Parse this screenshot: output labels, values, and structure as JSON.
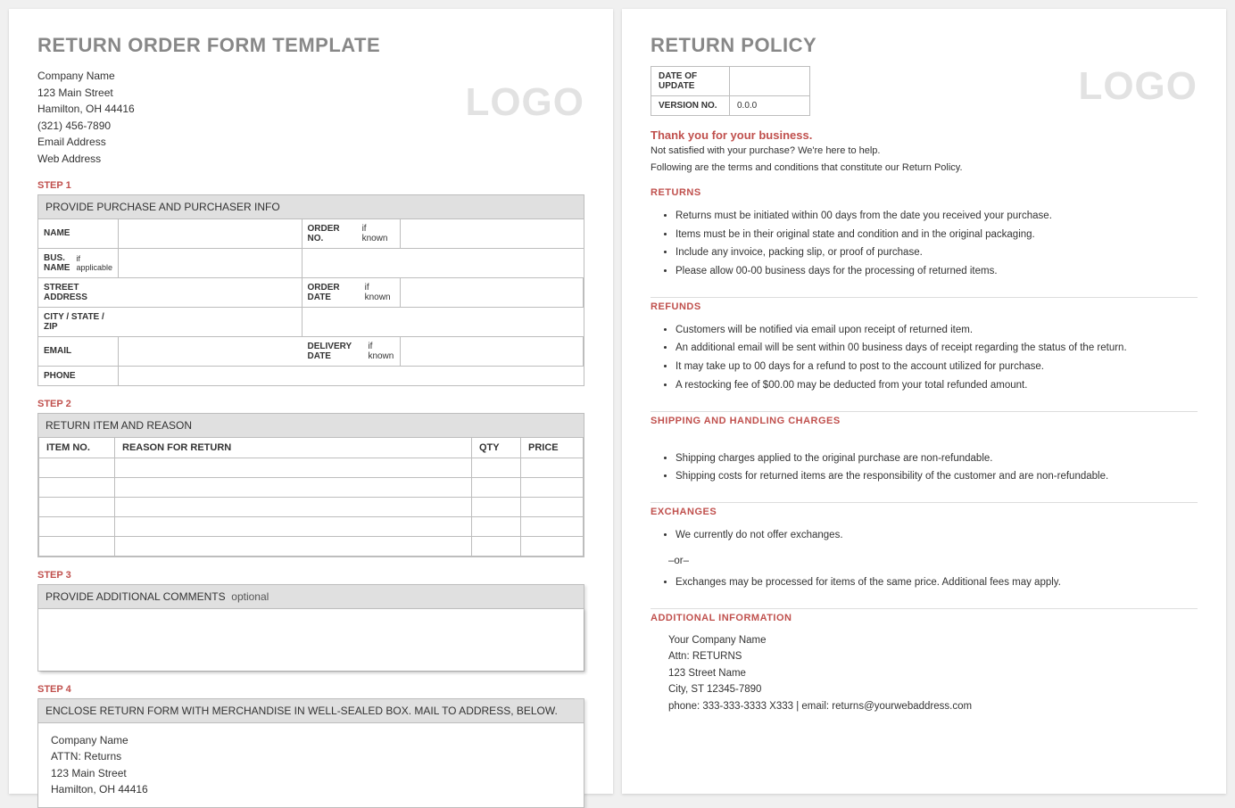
{
  "left": {
    "title": "RETURN ORDER FORM TEMPLATE",
    "logo": "LOGO",
    "company": {
      "name": "Company Name",
      "street": "123 Main Street",
      "city": "Hamilton, OH 44416",
      "phone": "(321) 456-7890",
      "email": "Email Address",
      "web": "Web Address"
    },
    "step1": {
      "label": "STEP 1",
      "header": "PROVIDE PURCHASE AND PURCHASER INFO",
      "rows": {
        "name": "NAME",
        "orderno": "ORDER NO.",
        "orderno_hint": "if known",
        "busname": "BUS. NAME",
        "busname_sub": "if applicable",
        "street": "STREET ADDRESS",
        "orderdate": "ORDER DATE",
        "orderdate_hint": "if known",
        "csz": "CITY / STATE / ZIP",
        "email": "EMAIL",
        "delivery": "DELIVERY DATE",
        "delivery_hint": "if known",
        "phone": "PHONE"
      }
    },
    "step2": {
      "label": "STEP 2",
      "header": "RETURN ITEM AND REASON",
      "cols": {
        "item": "ITEM NO.",
        "reason": "REASON FOR RETURN",
        "qty": "QTY",
        "price": "PRICE"
      }
    },
    "step3": {
      "label": "STEP 3",
      "header": "PROVIDE ADDITIONAL COMMENTS",
      "optional": "optional"
    },
    "step4": {
      "label": "STEP 4",
      "header": "ENCLOSE RETURN FORM WITH MERCHANDISE IN WELL-SEALED BOX.  MAIL TO ADDRESS, BELOW.",
      "mail": {
        "name": "Company Name",
        "attn": "ATTN: Returns",
        "street": "123 Main Street",
        "city": "Hamilton, OH 44416"
      }
    }
  },
  "right": {
    "title": "RETURN POLICY",
    "logo": "LOGO",
    "meta": {
      "date_lbl": "DATE OF UPDATE",
      "date_val": "",
      "ver_lbl": "VERSION NO.",
      "ver_val": "0.0.0"
    },
    "thank": "Thank you for your business.",
    "sub1": "Not satisfied with your purchase? We're here to help.",
    "sub2": "Following are the terms and conditions that constitute our Return Policy.",
    "sections": {
      "returns": {
        "title": "RETURNS",
        "items": [
          "Returns must be initiated within 00 days from the date you received your purchase.",
          "Items must be in their original state and condition and in the original packaging.",
          "Include any invoice, packing slip, or proof of purchase.",
          "Please allow 00-00 business days for the processing of returned items."
        ]
      },
      "refunds": {
        "title": "REFUNDS",
        "items": [
          "Customers will be notified via email upon receipt of returned item.",
          "An additional email will be sent within 00 business days of receipt regarding the status of the return.",
          "It may take up to 00 days for a refund to post to the account utilized for purchase.",
          "A restocking fee of $00.00 may be deducted from your total refunded amount."
        ]
      },
      "shipping": {
        "title": "SHIPPING AND HANDLING CHARGES",
        "items": [
          "Shipping charges applied to the original purchase are non-refundable.",
          "Shipping costs for returned items are the responsibility of the customer and are non-refundable."
        ]
      },
      "exchanges": {
        "title": "EXCHANGES",
        "items1": "We currently do not offer exchanges.",
        "or": "–or–",
        "items2": "Exchanges may be processed for items of the same price. Additional fees may apply."
      },
      "addl": {
        "title": "ADDITIONAL INFORMATION",
        "lines": [
          "Your Company Name",
          "Attn: RETURNS",
          "123 Street Name",
          "City, ST  12345-7890",
          "phone: 333-333-3333 X333    |    email: returns@yourwebaddress.com"
        ]
      }
    }
  }
}
